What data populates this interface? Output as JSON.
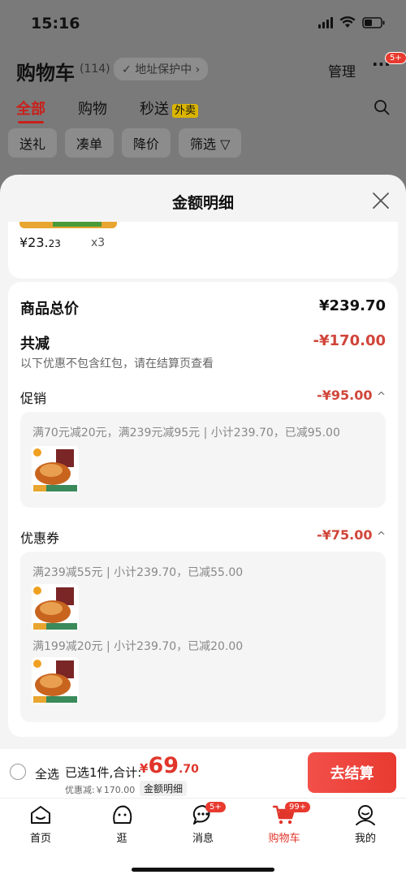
{
  "status": {
    "time": "15:16"
  },
  "header": {
    "title": "购物车",
    "count": "(114)",
    "address": "地址保护中",
    "manage": "管理",
    "more_badge": "5+",
    "tabs": [
      {
        "label": "全部"
      },
      {
        "label": "购物"
      },
      {
        "label": "秒送"
      }
    ],
    "tab_tag": "外卖",
    "filters": [
      "送礼",
      "凑单",
      "降价",
      "筛选"
    ]
  },
  "sheet": {
    "title": "金额明细",
    "top_item": {
      "price_int": "¥23.",
      "price_dec": "23",
      "qty": "x3"
    },
    "total_label": "商品总价",
    "total_value": "¥239.70",
    "reduce_label": "共减",
    "reduce_value": "-¥170.00",
    "note": "以下优惠不包含红包，请在结算页查看",
    "promo": {
      "label": "促销",
      "value": "-¥95.00",
      "line": "满70元减20元，满239元减95元 | 小计239.70，已减95.00"
    },
    "coupon": {
      "label": "优惠券",
      "value": "-¥75.00",
      "line1": "满239减55元 | 小计239.70，已减55.00",
      "line2": "满199减20元 | 小计239.70，已减20.00"
    }
  },
  "checkout": {
    "select_all": "全选",
    "selected": "已选1件,合计:",
    "yen": "¥",
    "total_int": "69",
    "total_dec": ".70",
    "discount": "优惠减:￥170.00",
    "detail": "金额明细",
    "pay": "去结算"
  },
  "nav": {
    "items": [
      {
        "label": "首页"
      },
      {
        "label": "逛"
      },
      {
        "label": "消息",
        "badge": "5+"
      },
      {
        "label": "购物车",
        "badge": "99+"
      },
      {
        "label": "我的"
      }
    ]
  },
  "colors": {
    "accent": "#e0352b",
    "discount": "#d0453a"
  }
}
